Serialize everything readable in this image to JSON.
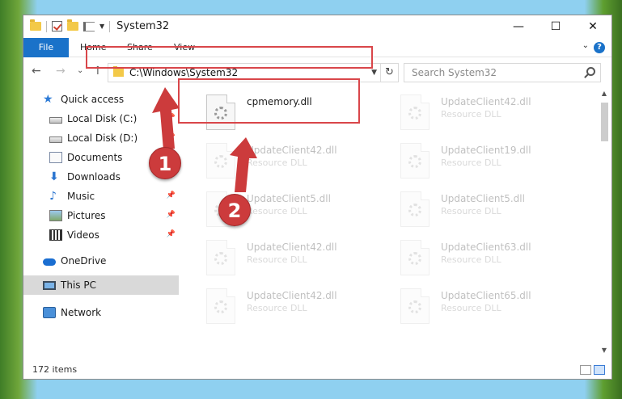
{
  "window": {
    "title": "System32",
    "controls": {
      "minimize": "—",
      "maximize": "☐",
      "close": "✕"
    }
  },
  "ribbon": {
    "tabs": [
      "File",
      "Home",
      "Share",
      "View"
    ],
    "help": "?"
  },
  "nav": {
    "back": "←",
    "forward": "→",
    "recent": "⌄",
    "up": "↑",
    "address": "C:\\Windows\\System32",
    "search_placeholder": "Search System32"
  },
  "sidebar": {
    "items": [
      {
        "label": "Quick access",
        "icon": "star-icon"
      },
      {
        "label": "Local Disk (C:)",
        "icon": "disk-icon",
        "pinned": true
      },
      {
        "label": "Local Disk (D:)",
        "icon": "disk-icon",
        "pinned": true
      },
      {
        "label": "Documents",
        "icon": "documents-icon",
        "pinned": true
      },
      {
        "label": "Downloads",
        "icon": "download-icon",
        "pinned": true
      },
      {
        "label": "Music",
        "icon": "music-icon",
        "pinned": true
      },
      {
        "label": "Pictures",
        "icon": "pictures-icon",
        "pinned": true
      },
      {
        "label": "Videos",
        "icon": "videos-icon",
        "pinned": true
      },
      {
        "label": "OneDrive",
        "icon": "cloud-icon"
      },
      {
        "label": "This PC",
        "icon": "pc-icon",
        "selected": true
      },
      {
        "label": "Network",
        "icon": "network-icon"
      }
    ]
  },
  "files": [
    {
      "name": "cpmemory.dll",
      "type": ""
    },
    {
      "name": "UpdateClient42.dll",
      "type": "Resource DLL"
    },
    {
      "name": "UpdateClient42.dll",
      "type": "Resource DLL"
    },
    {
      "name": "UpdateClient19.dll",
      "type": "Resource DLL"
    },
    {
      "name": "UpdateClient5.dll",
      "type": "Resource DLL"
    },
    {
      "name": "UpdateClient5.dll",
      "type": "Resource DLL"
    },
    {
      "name": "UpdateClient42.dll",
      "type": "Resource DLL"
    },
    {
      "name": "UpdateClient63.dll",
      "type": "Resource DLL"
    },
    {
      "name": "UpdateClient42.dll",
      "type": "Resource DLL"
    },
    {
      "name": "UpdateClient65.dll",
      "type": "Resource DLL"
    }
  ],
  "status": {
    "count": "172 items"
  },
  "callouts": {
    "one": "1",
    "two": "2"
  },
  "colors": {
    "accent": "#1a72c9",
    "highlight": "#d9464a",
    "callout": "#cc3b3c"
  }
}
